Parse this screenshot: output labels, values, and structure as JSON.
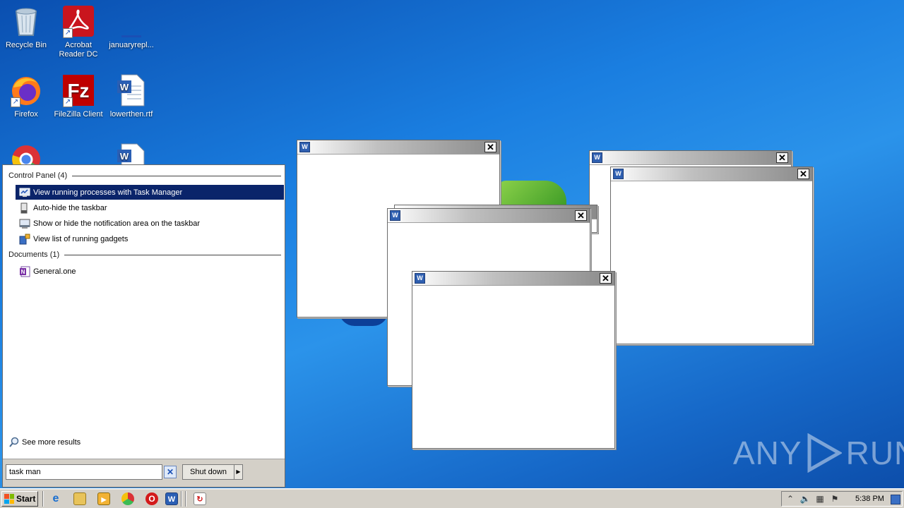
{
  "desktop": {
    "icons": [
      {
        "label": "Recycle Bin"
      },
      {
        "label": "Acrobat Reader DC"
      },
      {
        "label": "januaryrepl..."
      },
      {
        "label": "Firefox"
      },
      {
        "label": "FileZilla Client"
      },
      {
        "label": "lowerthen.rtf"
      },
      {
        "label": ""
      },
      {
        "label": ""
      }
    ],
    "watermark": {
      "left": "ANY",
      "right": "RUN"
    }
  },
  "start_menu": {
    "section_control_panel": "Control Panel (4)",
    "items_control_panel": [
      {
        "label": "View running processes with Task Manager"
      },
      {
        "label": "Auto-hide the taskbar"
      },
      {
        "label": "Show or hide the notification area on the taskbar"
      },
      {
        "label": "View list of running gadgets"
      }
    ],
    "section_documents": "Documents (1)",
    "items_documents": [
      {
        "label": "General.one"
      }
    ],
    "see_more": "See more results",
    "search_value": "task man",
    "shutdown_label": "Shut down"
  },
  "windows": {
    "icon_letter": "W",
    "close_glyph": "✕"
  },
  "taskbar": {
    "start_label": "Start",
    "clock": "5:38 PM"
  },
  "colors": {
    "selection": "#0a246a",
    "taskbar": "#d4d0c8"
  }
}
